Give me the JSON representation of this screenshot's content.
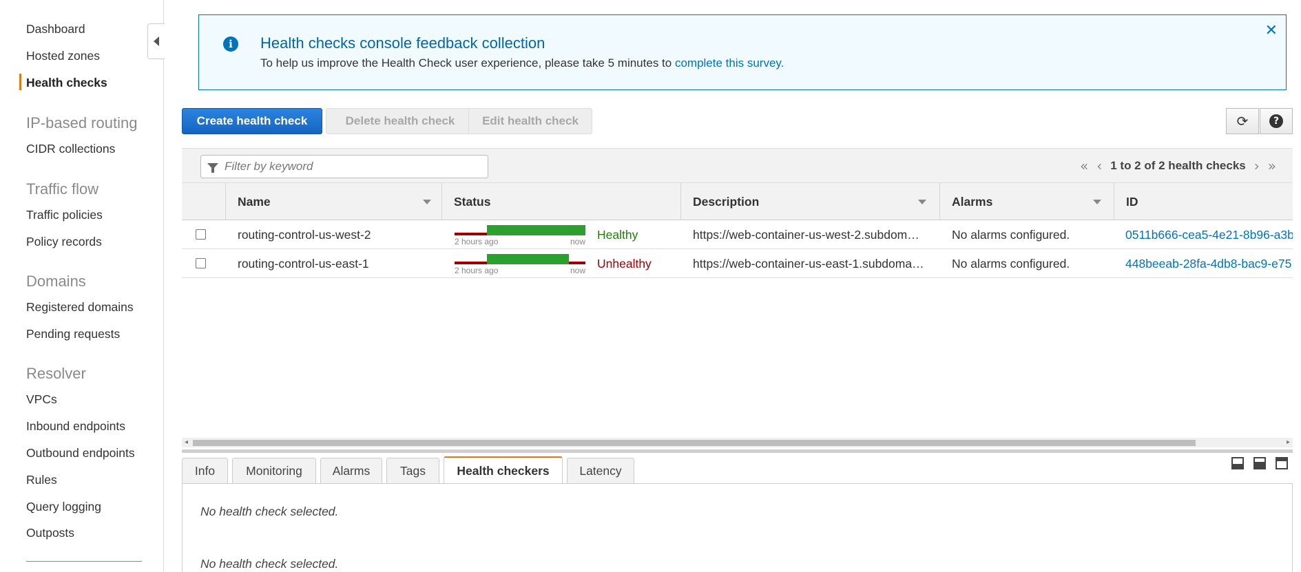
{
  "sidebar": {
    "items": [
      {
        "label": "Dashboard"
      },
      {
        "label": "Hosted zones"
      },
      {
        "label": "Health checks",
        "active": true
      }
    ],
    "sections": [
      {
        "heading": "IP-based routing",
        "items": [
          {
            "label": "CIDR collections"
          }
        ]
      },
      {
        "heading": "Traffic flow",
        "items": [
          {
            "label": "Traffic policies"
          },
          {
            "label": "Policy records"
          }
        ]
      },
      {
        "heading": "Domains",
        "items": [
          {
            "label": "Registered domains"
          },
          {
            "label": "Pending requests"
          }
        ]
      },
      {
        "heading": "Resolver",
        "items": [
          {
            "label": "VPCs"
          },
          {
            "label": "Inbound endpoints"
          },
          {
            "label": "Outbound endpoints"
          },
          {
            "label": "Rules"
          },
          {
            "label": "Query logging"
          },
          {
            "label": "Outposts"
          }
        ]
      }
    ]
  },
  "banner": {
    "title": "Health checks console feedback collection",
    "message": "To help us improve the Health Check user experience, please take 5 minutes to ",
    "link_text": "complete this survey",
    "message_end": "."
  },
  "toolbar": {
    "create_label": "Create health check",
    "delete_label": "Delete health check",
    "edit_label": "Edit health check"
  },
  "filter": {
    "placeholder": "Filter by keyword",
    "value": ""
  },
  "pager": {
    "summary": "1 to 2 of 2 health checks"
  },
  "table": {
    "columns": [
      "Name",
      "Status",
      "Description",
      "Alarms",
      "ID"
    ],
    "rows": [
      {
        "name": "routing-control-us-west-2",
        "status": "Healthy",
        "spark_start": "2 hours ago",
        "spark_end": "now",
        "description": "https://web-container-us-west-2.subdom…",
        "alarms": "No alarms configured.",
        "id": "0511b666-cea5-4e21-8b96-a3b"
      },
      {
        "name": "routing-control-us-east-1",
        "status": "Unhealthy",
        "spark_start": "2 hours ago",
        "spark_end": "now",
        "description": "https://web-container-us-east-1.subdoma…",
        "alarms": "No alarms configured.",
        "id": "448beeab-28fa-4db8-bac9-e75"
      }
    ]
  },
  "tabs": [
    "Info",
    "Monitoring",
    "Alarms",
    "Tags",
    "Health checkers",
    "Latency"
  ],
  "active_tab": "Health checkers",
  "panel": {
    "empty_1": "No health check selected.",
    "empty_2": "No health check selected."
  },
  "colors": {
    "primary": "#1a6fd0",
    "accent": "#e07b10",
    "healthy": "#1d8102",
    "unhealthy": "#a00000",
    "link": "#0073bb"
  }
}
